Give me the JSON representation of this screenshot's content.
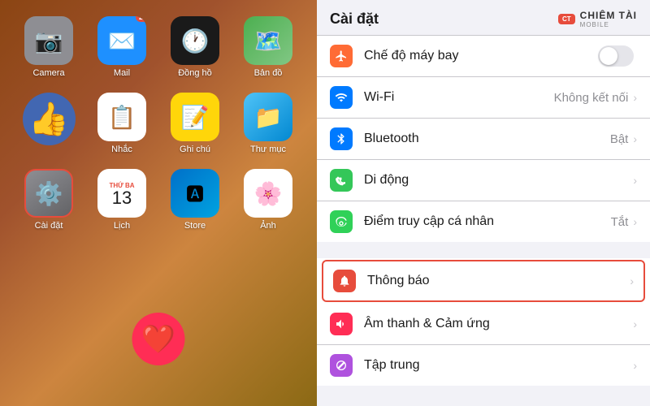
{
  "leftPanel": {
    "apps": [
      {
        "id": "camera",
        "label": "Camera",
        "icon": "camera",
        "badge": null
      },
      {
        "id": "mail",
        "label": "Mail",
        "icon": "mail",
        "badge": "24"
      },
      {
        "id": "clock",
        "label": "Đồng hồ",
        "icon": "clock",
        "badge": null
      },
      {
        "id": "maps",
        "label": "Bản đồ",
        "icon": "maps",
        "badge": null
      },
      {
        "id": "facebook",
        "label": "",
        "icon": "facebook",
        "badge": null
      },
      {
        "id": "reminders",
        "label": "Nhắc",
        "icon": "reminders",
        "badge": null
      },
      {
        "id": "notes",
        "label": "Ghi chú",
        "icon": "notes",
        "badge": null
      },
      {
        "id": "files",
        "label": "Thư mục",
        "icon": "files",
        "badge": null
      },
      {
        "id": "settings",
        "label": "Cài đặt",
        "icon": "settings",
        "badge": null,
        "highlighted": true
      },
      {
        "id": "calendar",
        "label": "Lịch",
        "icon": "calendar",
        "badge": null
      },
      {
        "id": "appstore",
        "label": "Store",
        "icon": "appstore",
        "badge": null
      },
      {
        "id": "photos",
        "label": "Ảnh",
        "icon": "photos",
        "badge": null
      }
    ],
    "calDay": "THỨ BA",
    "calDate": "13"
  },
  "rightPanel": {
    "title": "Cài đặt",
    "logo": {
      "badge": "CT",
      "name": "CHIÊM TÀI",
      "sub": "MOBILE"
    },
    "rows": [
      {
        "id": "airplane",
        "label": "Chế độ máy bay",
        "icon": "airplane",
        "iconBg": "bg-orange",
        "value": "",
        "type": "toggle",
        "toggleOn": false
      },
      {
        "id": "wifi",
        "label": "Wi-Fi",
        "icon": "wifi",
        "iconBg": "bg-blue",
        "value": "Không kết nối",
        "type": "chevron"
      },
      {
        "id": "bluetooth",
        "label": "Bluetooth",
        "icon": "bluetooth",
        "iconBg": "bg-blue",
        "value": "Bật",
        "type": "chevron"
      },
      {
        "id": "mobile",
        "label": "Di động",
        "icon": "mobile",
        "iconBg": "bg-green",
        "value": "",
        "type": "chevron"
      },
      {
        "id": "hotspot",
        "label": "Điểm truy cập cá nhân",
        "icon": "hotspot",
        "iconBg": "bg-green",
        "value": "Tắt",
        "type": "chevron"
      }
    ],
    "rows2": [
      {
        "id": "notifications",
        "label": "Thông báo",
        "icon": "bell",
        "iconBg": "bg-red",
        "value": "",
        "type": "chevron",
        "highlighted": true
      },
      {
        "id": "sound",
        "label": "Âm thanh & Cảm ứng",
        "icon": "sound",
        "iconBg": "bg-pink",
        "value": "",
        "type": "chevron"
      },
      {
        "id": "focus",
        "label": "Tập trung",
        "icon": "moon",
        "iconBg": "bg-purple",
        "value": "",
        "type": "chevron"
      }
    ]
  }
}
